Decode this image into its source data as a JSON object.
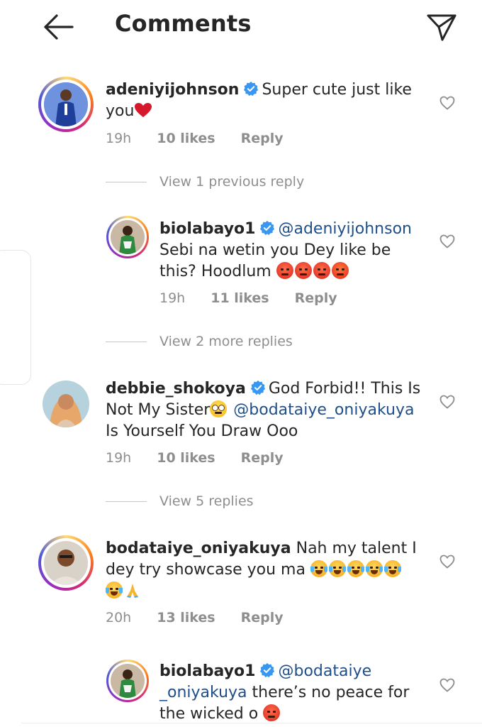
{
  "header": {
    "title": "Comments",
    "back_icon": "arrow-left-icon",
    "share_icon": "paper-plane-icon"
  },
  "colors": {
    "text": "#262626",
    "muted": "#8e8e8e",
    "mention": "#1f4f8a",
    "verified": "#3897f0"
  },
  "comments": [
    {
      "username": "adeniyijohnson",
      "verified": true,
      "text_line1": "Super cute just like",
      "text_line2": "you",
      "emojis": [
        "red-heart"
      ],
      "time": "19h",
      "likes": "10 likes",
      "reply": "Reply"
    },
    {
      "view_replies": "View 1 previous reply"
    },
    {
      "username": "biolabayo1",
      "verified": true,
      "mention": "@adeniyijohnson",
      "text_line2": "Sebi na wetin you Dey like be",
      "text_line3": "this? Hoodlum",
      "emojis": [
        "angry-face",
        "angry-face",
        "angry-face",
        "steaming-face"
      ],
      "time": "19h",
      "likes": "11 likes",
      "reply": "Reply"
    },
    {
      "view_replies": "View 2 more replies"
    },
    {
      "username": "debbie_shokoya",
      "verified": true,
      "text_line1": "God Forbid!! This Is",
      "text_line2": "Not My Sister",
      "mention": "@bodataiye_oniyakuya",
      "text_line3": "Is Yourself You Draw Ooo",
      "emojis": [
        "eye-roll-face"
      ],
      "time": "19h",
      "likes": "10 likes",
      "reply": "Reply"
    },
    {
      "view_replies": "View 5 replies"
    },
    {
      "username": "bodataiye_oniyakuya",
      "verified": false,
      "text_line1": "Nah my talent I",
      "text_line2": "dey try showcase you ma",
      "emojis": [
        "tears-of-joy",
        "tears-of-joy",
        "tears-of-joy",
        "tears-of-joy",
        "tears-of-joy",
        "tears-of-joy",
        "folded-hands"
      ],
      "time": "20h",
      "likes": "13 likes",
      "reply": "Reply"
    },
    {
      "username": "biolabayo1",
      "verified": true,
      "mention_line1": "@bodataiye",
      "mention_line2": "_oniyakuya",
      "text_line2": "there’s no peace for",
      "text_line3": "the wicked o",
      "emojis": [
        "angry-face"
      ]
    }
  ]
}
